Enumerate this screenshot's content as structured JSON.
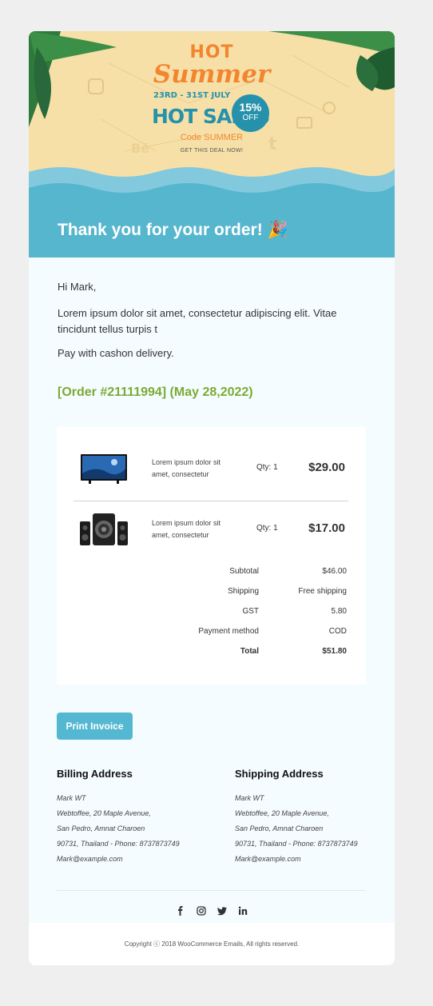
{
  "banner": {
    "hot": "HOT",
    "summer": "Summer",
    "dates": "23RD - 31ST JULY",
    "hot_sales": "HOT SALES",
    "discount_pct": "15%",
    "discount_off": "OFF",
    "code": "Code SUMMER",
    "cta": "GET THIS DEAL NOW!"
  },
  "header": {
    "title": "Thank you for your order!",
    "emoji": "🎉"
  },
  "message": {
    "greeting": "Hi Mark,",
    "body": "Lorem ipsum dolor sit amet, consectetur adipiscing elit. Vitae tincidunt tellus turpis t",
    "payment_note": "Pay with cashon delivery."
  },
  "order": {
    "heading": "[Order #21111994] (May 28,2022)",
    "items": [
      {
        "image": "tv-icon",
        "description": "Lorem ipsum dolor sit amet, consectetur",
        "qty": "Qty: 1",
        "price": "$29.00"
      },
      {
        "image": "speaker-system-icon",
        "description": "Lorem ipsum dolor sit amet, consectetur",
        "qty": "Qty: 1",
        "price": "$17.00"
      }
    ],
    "totals": [
      {
        "label": "Subtotal",
        "value": "$46.00"
      },
      {
        "label": "Shipping",
        "value": "Free shipping"
      },
      {
        "label": "GST",
        "value": "5.80"
      },
      {
        "label": "Payment method",
        "value": "COD"
      },
      {
        "label": "Total",
        "value": "$51.80"
      }
    ]
  },
  "actions": {
    "print_invoice": "Print Invoice"
  },
  "billing": {
    "heading": "Billing Address",
    "lines": [
      "Mark WT",
      "Webtoffee, 20 Maple Avenue,",
      "San Pedro, Amnat Charoen",
      "90731, Thailand - Phone: 8737873749",
      "Mark@example.com"
    ]
  },
  "shipping": {
    "heading": "Shipping Address",
    "lines": [
      "Mark WT",
      "Webtoffee, 20 Maple Avenue,",
      "San Pedro, Amnat Charoen",
      "90731, Thailand - Phone: 8737873749",
      "Mark@example.com"
    ]
  },
  "social": [
    "facebook-icon",
    "instagram-icon",
    "twitter-icon",
    "linkedin-icon"
  ],
  "footer": {
    "copyright": "Copyright ⓒ 2018 WooCommerce Emails, All rights reserved."
  },
  "colors": {
    "page_bg": "#efefef",
    "banner_sand": "#f6e0a8",
    "title_band": "#56b6cd",
    "accent_orange": "#f2852e",
    "order_green": "#7aab34",
    "button": "#55b8d2",
    "content_bg": "#f5fcff"
  }
}
